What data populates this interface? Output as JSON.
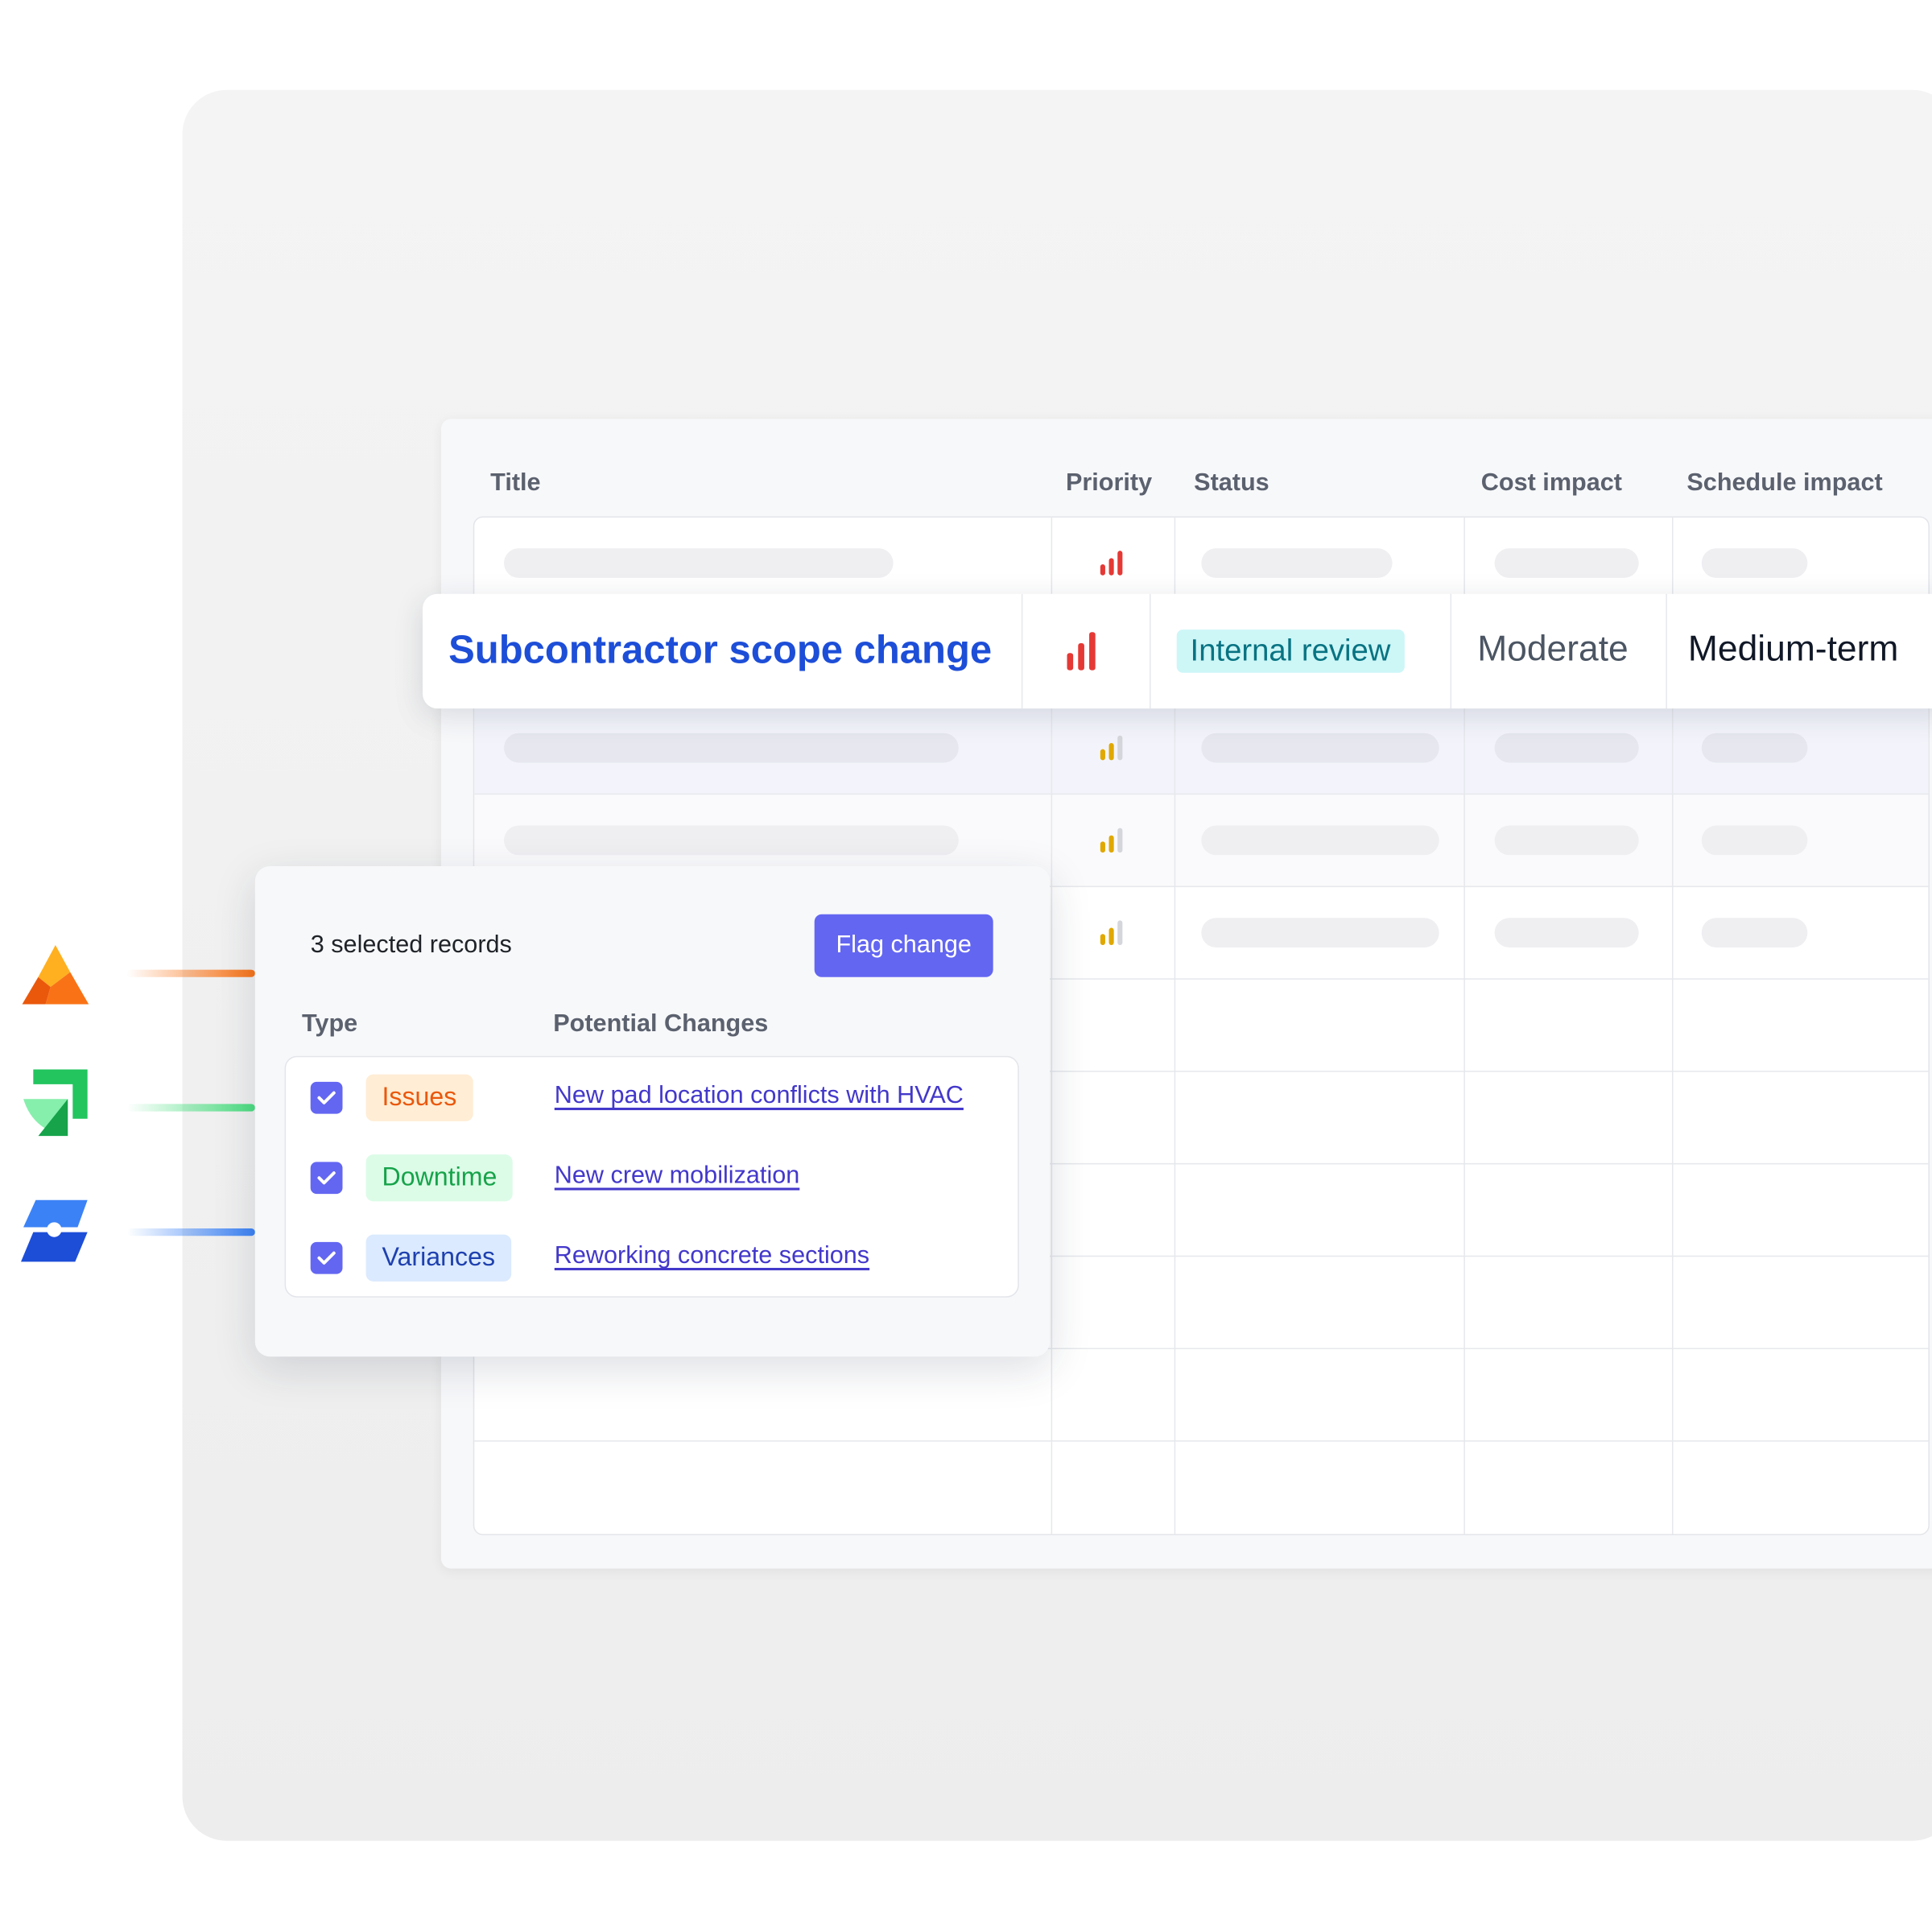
{
  "table": {
    "headers": {
      "title": "Title",
      "priority": "Priority",
      "status": "Status",
      "cost": "Cost impact",
      "schedule": "Schedule impact"
    }
  },
  "highlight": {
    "title": "Subcontractor scope change",
    "status": "Internal review",
    "cost": "Moderate",
    "schedule": "Medium-term"
  },
  "popup": {
    "selected_count": "3 selected records",
    "flag_button": "Flag change",
    "col_type": "Type",
    "col_changes": "Potential Changes",
    "items": [
      {
        "type": "Issues",
        "change": "New pad location conflicts with HVAC",
        "checked": true
      },
      {
        "type": "Downtime",
        "change": "New crew mobilization",
        "checked": true
      },
      {
        "type": "Variances",
        "change": "Reworking concrete sections",
        "checked": true
      }
    ]
  },
  "colors": {
    "accent": "#6366f1",
    "title_link": "#1d4ed8",
    "priority_high": "#e53935",
    "priority_medium": "#e0a800",
    "status_bg": "#cdf6f7",
    "issues": "#ea580c",
    "downtime": "#16a34a",
    "variances": "#1e40af"
  },
  "icons": [
    "priority-high-icon",
    "priority-medium-icon",
    "checkbox-checked-icon",
    "orange-app-logo-icon",
    "green-app-logo-icon",
    "blue-app-logo-icon"
  ]
}
